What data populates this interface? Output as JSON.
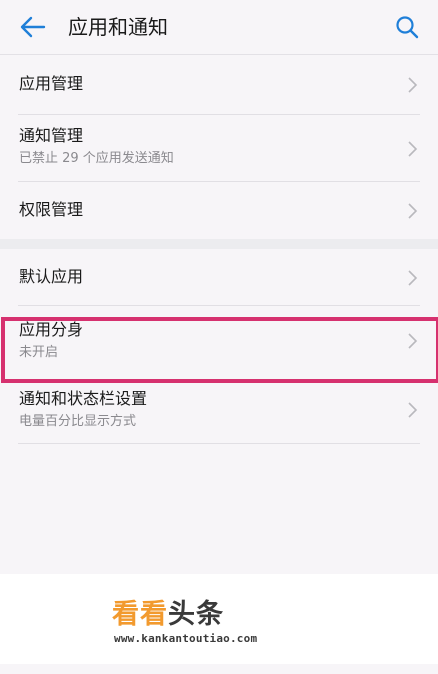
{
  "header": {
    "title": "应用和通知",
    "back_icon": "arrow-left-icon",
    "search_icon": "search-icon",
    "accent_color": "#1f7fd8"
  },
  "settings": {
    "group1": [
      {
        "title": "应用管理",
        "subtitle": ""
      },
      {
        "title": "通知管理",
        "subtitle": "已禁止 29 个应用发送通知"
      },
      {
        "title": "权限管理",
        "subtitle": ""
      }
    ],
    "group2": [
      {
        "title": "默认应用",
        "subtitle": ""
      },
      {
        "title": "应用分身",
        "subtitle": "未开启"
      },
      {
        "title": "通知和状态栏设置",
        "subtitle": "电量百分比显示方式"
      }
    ]
  },
  "highlight": {
    "target": "应用分身",
    "color": "#d6316f"
  },
  "watermark": {
    "brand_part1": "看看",
    "brand_part2": "头条",
    "url": "www.kankantoutiao.com"
  }
}
